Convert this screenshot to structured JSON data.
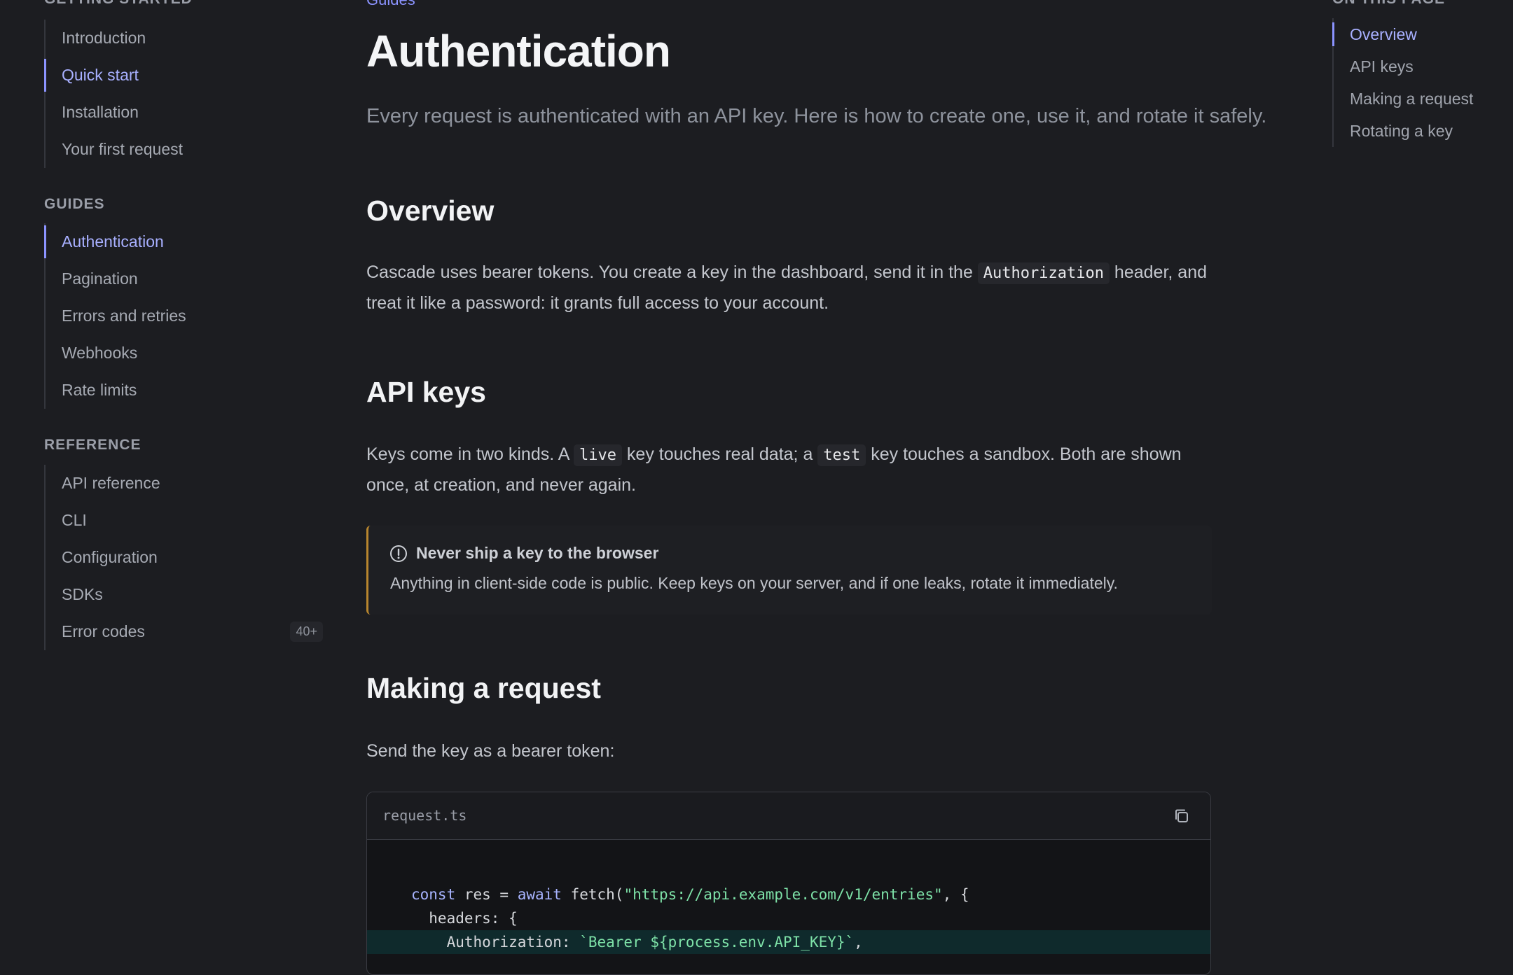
{
  "sidebar": {
    "getting_started": {
      "title": "GETTING STARTED",
      "items": [
        {
          "label": "Introduction"
        },
        {
          "label": "Quick start"
        },
        {
          "label": "Installation"
        },
        {
          "label": "Your first request"
        }
      ]
    },
    "guides": {
      "title": "GUIDES",
      "items": [
        {
          "label": "Authentication"
        },
        {
          "label": "Pagination"
        },
        {
          "label": "Errors and retries"
        },
        {
          "label": "Webhooks"
        },
        {
          "label": "Rate limits"
        }
      ]
    },
    "reference": {
      "title": "REFERENCE",
      "items": [
        {
          "label": "API reference"
        },
        {
          "label": "CLI"
        },
        {
          "label": "Configuration"
        },
        {
          "label": "SDKs"
        },
        {
          "label": "Error codes",
          "badge": "40+"
        }
      ]
    }
  },
  "main": {
    "breadcrumb": "Guides",
    "title": "Authentication",
    "lead": "Every request is authenticated with an API key. Here is how to create one, use it, and rotate it safely.",
    "overview": {
      "heading": "Overview",
      "text_1": "Cascade uses bearer tokens. You create a key in the dashboard, send it in the ",
      "code": "Authorization",
      "text_2": " header, and treat it like a password: it grants full access to your account."
    },
    "api_keys": {
      "heading": "API keys",
      "text_1": "Keys come in two kinds. A ",
      "code_1": "live",
      "text_2": " key touches real data; a ",
      "code_2": "test",
      "text_3": " key touches a sandbox. Both are shown once, at creation, and never again."
    },
    "callout": {
      "icon": "alert-circle-icon",
      "title": "Never ship a key to the browser",
      "body": "Anything in client-side code is public. Keep keys on your server, and if one leaks, rotate it immediately."
    },
    "making_request": {
      "heading": "Making a request",
      "text": "Send the key as a bearer token:"
    },
    "code_block": {
      "filename": "request.ts",
      "copy_icon": "copy-icon",
      "line1": {
        "kw1": "const",
        "t1": " res = ",
        "kw2": "await",
        "t2": " fetch(",
        "str": "\"https://api.example.com/v1/entries\"",
        "t3": ", {"
      },
      "line2": "  headers: {",
      "line3": {
        "t1": "    Authorization: ",
        "str": "`Bearer ${process.env.API_KEY}`",
        "t2": ","
      }
    }
  },
  "toc": {
    "title": "ON THIS PAGE",
    "items": [
      {
        "label": "Overview"
      },
      {
        "label": "API keys"
      },
      {
        "label": "Making a request"
      },
      {
        "label": "Rotating a key"
      }
    ]
  },
  "colors": {
    "background": "#1c1d21",
    "accent": "#8b93ff",
    "callout_border": "#b8862e",
    "code_string": "#7ee2a8",
    "code_keyword": "#a8b4ff"
  }
}
